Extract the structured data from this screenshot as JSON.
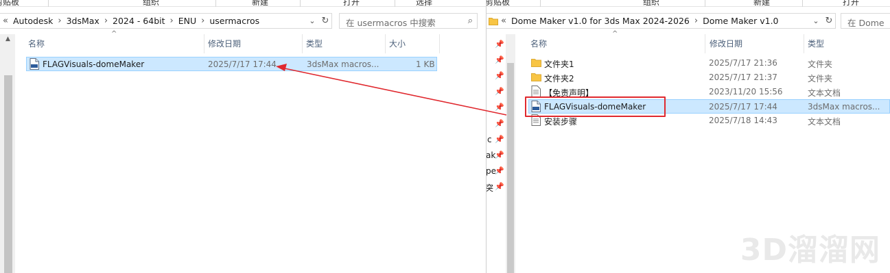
{
  "left": {
    "ribbon": [
      "剪贴板",
      "组织",
      "新建",
      "打开",
      "选择"
    ],
    "breadcrumb": [
      "Autodesk",
      "3dsMax",
      "2024 - 64bit",
      "ENU",
      "usermacros"
    ],
    "search_placeholder": "在 usermacros 中搜索",
    "columns": {
      "name": "名称",
      "date": "修改日期",
      "type": "类型",
      "size": "大小"
    },
    "files": [
      {
        "name": "FLAGVisuals-domeMaker",
        "date": "2025/7/17 17:44",
        "type": "3dsMax macros...",
        "size": "1 KB",
        "icon": "macro-file-icon",
        "selected": true
      }
    ]
  },
  "right": {
    "ribbon": [
      "剪贴板",
      "组织",
      "新建",
      "打开"
    ],
    "breadcrumb": [
      "Dome Maker v1.0 for 3ds Max 2024-2026",
      "Dome Maker v1.0"
    ],
    "search_placeholder": "在 Dome",
    "columns": {
      "name": "名称",
      "date": "修改日期",
      "type": "类型"
    },
    "nav_fragments": [
      "c",
      "ak",
      "pe",
      "突"
    ],
    "files": [
      {
        "name": "文件夹1",
        "date": "2025/7/17 21:36",
        "type": "文件夹",
        "icon": "folder-icon",
        "selected": false
      },
      {
        "name": "文件夹2",
        "date": "2025/7/17 21:37",
        "type": "文件夹",
        "icon": "folder-icon",
        "selected": false
      },
      {
        "name": "【免责声明】",
        "date": "2023/11/20 15:56",
        "type": "文本文档",
        "icon": "text-file-icon",
        "selected": false
      },
      {
        "name": "FLAGVisuals-domeMaker",
        "date": "2025/7/17 17:44",
        "type": "3dsMax macros...",
        "icon": "macro-file-icon",
        "selected": true
      },
      {
        "name": "安装步骤",
        "date": "2025/7/18 14:43",
        "type": "文本文档",
        "icon": "text-file-icon",
        "selected": false
      }
    ]
  },
  "watermark": "3D溜溜网",
  "colors": {
    "selection": "#cce8ff",
    "selection_border": "#99d1ff",
    "annotation": "#e0282e",
    "folder": "#f8c545"
  }
}
